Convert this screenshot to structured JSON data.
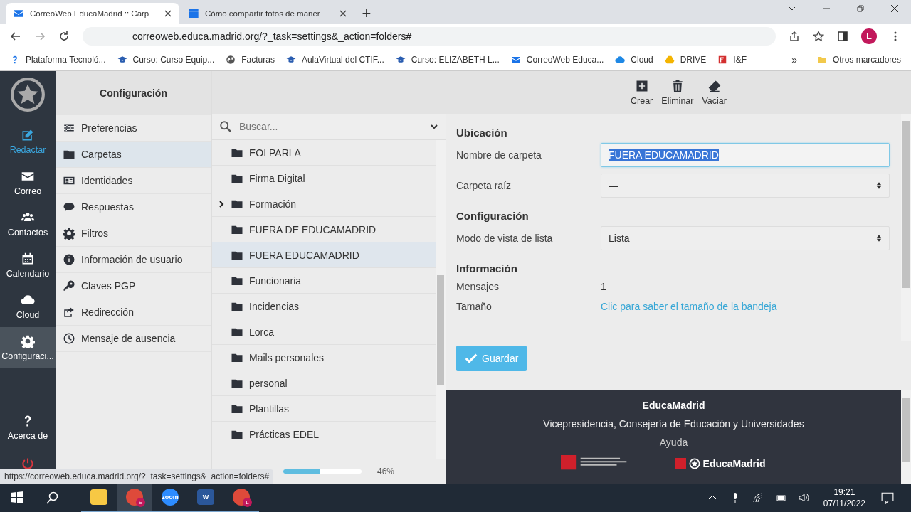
{
  "browser": {
    "tabs": [
      {
        "title": "CorreoWeb EducaMadrid :: Carp",
        "kind": "mail",
        "selected": true
      },
      {
        "title": "Cómo compartir fotos de maner",
        "kind": "video",
        "selected": false
      }
    ],
    "new_tab": "+",
    "address": "correoweb.educa.madrid.org/?_task=settings&_action=folders#",
    "profile": "E",
    "bookmarks": [
      {
        "label": "Plataforma Tecnoló...",
        "kind": "help"
      },
      {
        "label": "Curso: Curso Equip...",
        "kind": "cap"
      },
      {
        "label": "Facturas",
        "kind": "globe"
      },
      {
        "label": "AulaVirtual del CTIF...",
        "kind": "cap"
      },
      {
        "label": "Curso: ELIZABETH L...",
        "kind": "cap"
      },
      {
        "label": "CorreoWeb Educa...",
        "kind": "mail"
      },
      {
        "label": "Cloud",
        "kind": "cloud"
      },
      {
        "label": "DRIVE",
        "kind": "drive"
      },
      {
        "label": "I&F",
        "kind": "flag"
      }
    ],
    "more": "»",
    "other_bookmarks": "Otros marcadores"
  },
  "nav": {
    "items": [
      {
        "label": "Redactar",
        "kind": "compose",
        "selected": false
      },
      {
        "label": "Correo",
        "kind": "mail",
        "selected": false
      },
      {
        "label": "Contactos",
        "kind": "contacts",
        "selected": false
      },
      {
        "label": "Calendario",
        "kind": "calendar",
        "selected": false
      },
      {
        "label": "Cloud",
        "kind": "cloud",
        "selected": false
      },
      {
        "label": "Configuraci...",
        "kind": "gear",
        "selected": true
      }
    ],
    "bottom": [
      {
        "label": "Acerca de",
        "kind": "help"
      }
    ]
  },
  "settings": {
    "title": "Configuración",
    "items": [
      {
        "label": "Preferencias",
        "kind": "sliders",
        "selected": false
      },
      {
        "label": "Carpetas",
        "kind": "folder",
        "selected": true
      },
      {
        "label": "Identidades",
        "kind": "idcard",
        "selected": false
      },
      {
        "label": "Respuestas",
        "kind": "bubble",
        "selected": false
      },
      {
        "label": "Filtros",
        "kind": "gear",
        "selected": false
      },
      {
        "label": "Información de usuario",
        "kind": "info",
        "selected": false
      },
      {
        "label": "Claves PGP",
        "kind": "key",
        "selected": false
      },
      {
        "label": "Redirección",
        "kind": "share",
        "selected": false
      },
      {
        "label": "Mensaje de ausencia",
        "kind": "clock",
        "selected": false
      }
    ]
  },
  "folders": {
    "search_placeholder": "Buscar...",
    "items": [
      {
        "name": "EOI PARLA",
        "expandable": false,
        "selected": false
      },
      {
        "name": "Firma Digital",
        "expandable": false,
        "selected": false
      },
      {
        "name": "Formación",
        "expandable": true,
        "selected": false
      },
      {
        "name": "FUERA DE EDUCAMADRID",
        "expandable": false,
        "selected": false
      },
      {
        "name": "FUERA EDUCAMADRID",
        "expandable": false,
        "selected": true
      },
      {
        "name": "Funcionaria",
        "expandable": false,
        "selected": false
      },
      {
        "name": "Incidencias",
        "expandable": false,
        "selected": false
      },
      {
        "name": "Lorca",
        "expandable": false,
        "selected": false
      },
      {
        "name": "Mails personales",
        "expandable": false,
        "selected": false
      },
      {
        "name": "personal",
        "expandable": false,
        "selected": false
      },
      {
        "name": "Plantillas",
        "expandable": false,
        "selected": false
      },
      {
        "name": "Prácticas EDEL",
        "expandable": false,
        "selected": false
      }
    ],
    "quota": {
      "level": 0.46,
      "reading": "46%"
    }
  },
  "toolbar": {
    "buttons": [
      {
        "label": "Crear",
        "kind": "create"
      },
      {
        "label": "Eliminar",
        "kind": "delete"
      },
      {
        "label": "Vaciar",
        "kind": "empty"
      }
    ]
  },
  "form": {
    "sections": [
      {
        "title": "Ubicación",
        "rows": [
          {
            "label": "Nombre de carpeta",
            "kind": "text",
            "value": "FUERA EDUCAMADRID"
          },
          {
            "label": "Carpeta raíz",
            "kind": "select",
            "value": "—"
          }
        ]
      },
      {
        "title": "Configuración",
        "rows": [
          {
            "label": "Modo de vista de lista",
            "kind": "select",
            "value": "Lista"
          }
        ]
      },
      {
        "title": "Información",
        "rows": [
          {
            "label": "Mensajes",
            "kind": "static",
            "value": "1"
          },
          {
            "label": "Tamaño",
            "kind": "link",
            "value": "Clic para saber el tamaño de la bandeja"
          }
        ]
      }
    ],
    "save": "Guardar"
  },
  "footer": {
    "title": "EducaMadrid",
    "subtitle": "Vicepresidencia, Consejería de Educación y Universidades",
    "link": "Ayuda",
    "logo": "EducaMadrid"
  },
  "status_url": "https://correoweb.educa.madrid.org/?_task=settings&_action=folders#",
  "taskbar": {
    "apps": [
      {
        "kind": "explorer",
        "selected": false
      },
      {
        "kind": "chrome",
        "label": "E",
        "selected": true
      },
      {
        "kind": "zoom",
        "label": "zoom",
        "selected": false
      },
      {
        "kind": "word",
        "label": "W",
        "selected": false
      },
      {
        "kind": "chrome",
        "label": "L",
        "selected": false
      }
    ],
    "time": "19:21",
    "date": "07/11/2022"
  }
}
